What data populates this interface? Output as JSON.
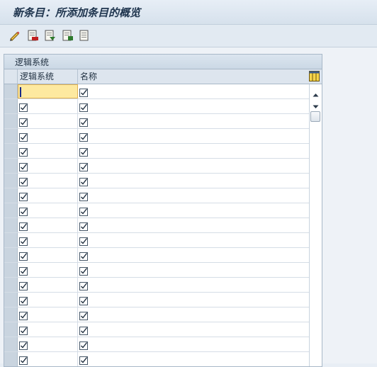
{
  "window": {
    "title": "新条目：所添加条目的概览"
  },
  "toolbar": {
    "buttons": [
      {
        "icon": "display-change-icon"
      },
      {
        "icon": "delete-entry-icon"
      },
      {
        "icon": "select-all-icon"
      },
      {
        "icon": "select-block-icon"
      },
      {
        "icon": "deselect-all-icon"
      }
    ]
  },
  "table": {
    "caption": "逻辑系统",
    "columns": [
      "逻辑系统",
      "名称"
    ],
    "visible_row_count": 19,
    "active_cell": {
      "row": 0,
      "column": 0,
      "value": ""
    },
    "row_state": "empty-input-row"
  },
  "colors": {
    "title_text": "#20364f",
    "active_cell": "#fde9a0",
    "header_bg": "#dde5ee"
  }
}
